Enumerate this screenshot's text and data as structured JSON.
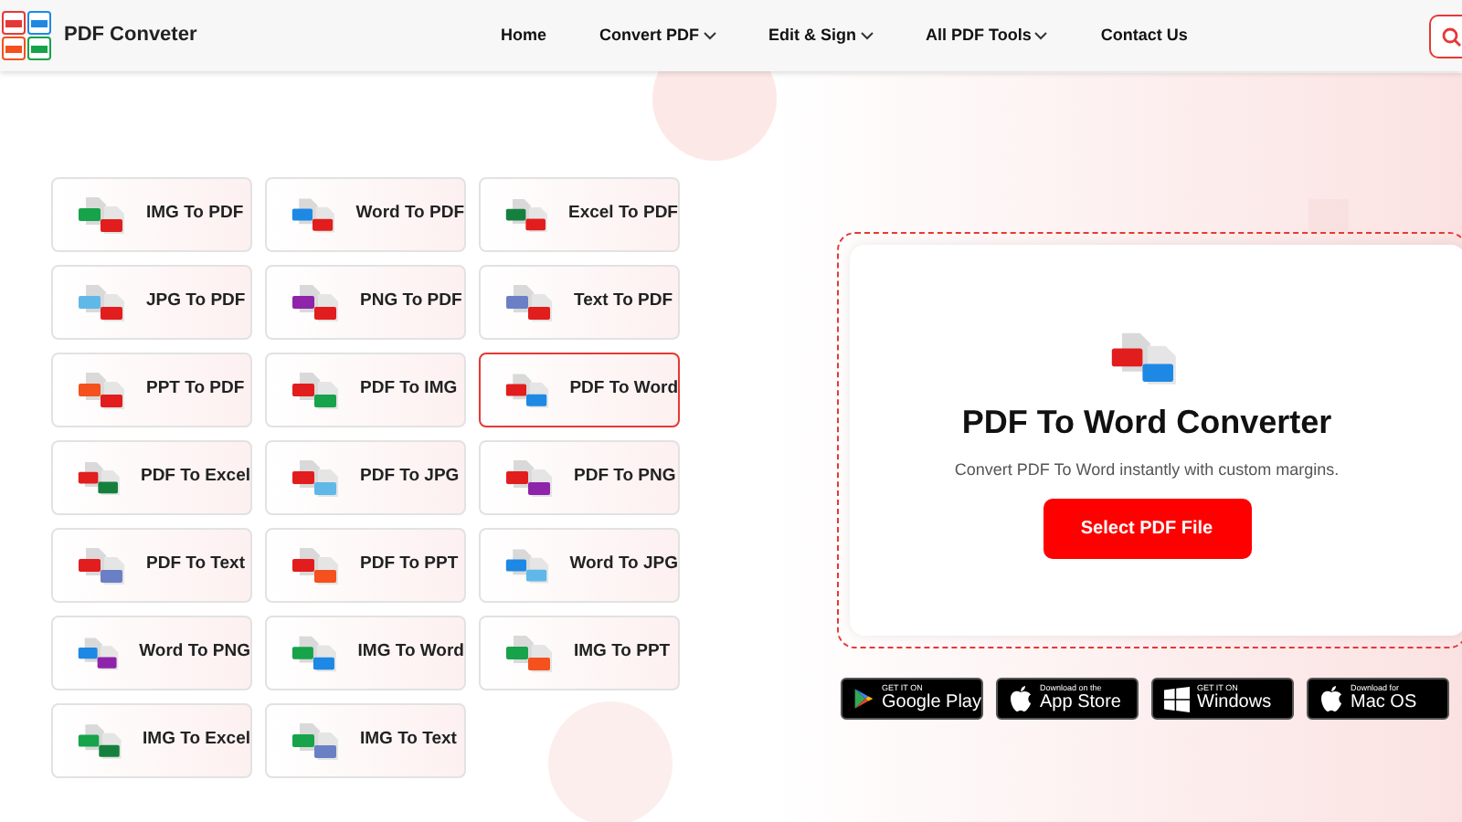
{
  "header": {
    "brand": "PDF Conveter",
    "nav": [
      {
        "label": "Home",
        "dropdown": false
      },
      {
        "label": "Convert PDF",
        "dropdown": true
      },
      {
        "label": "Edit & Sign",
        "dropdown": true
      },
      {
        "label": "All PDF Tools",
        "dropdown": true
      },
      {
        "label": "Contact Us",
        "dropdown": false
      }
    ]
  },
  "tools": [
    {
      "label": "IMG To PDF",
      "selected": false,
      "badges": [
        {
          "color": "#16a34a"
        },
        {
          "color": "#e11d1d"
        }
      ]
    },
    {
      "label": "Word To PDF",
      "selected": false,
      "badges": [
        {
          "color": "#1e88e5"
        },
        {
          "color": "#e11d1d"
        }
      ]
    },
    {
      "label": "Excel To PDF",
      "selected": false,
      "badges": [
        {
          "color": "#15803d"
        },
        {
          "color": "#e11d1d"
        }
      ]
    },
    {
      "label": "JPG To PDF",
      "selected": false,
      "badges": [
        {
          "color": "#60b8e8"
        },
        {
          "color": "#e11d1d"
        }
      ]
    },
    {
      "label": "PNG To PDF",
      "selected": false,
      "badges": [
        {
          "color": "#8e24aa"
        },
        {
          "color": "#e11d1d"
        }
      ]
    },
    {
      "label": "Text To PDF",
      "selected": false,
      "badges": [
        {
          "color": "#6b7fc4"
        },
        {
          "color": "#e11d1d"
        }
      ]
    },
    {
      "label": "PPT To PDF",
      "selected": false,
      "badges": [
        {
          "color": "#f4511e"
        },
        {
          "color": "#e11d1d"
        }
      ]
    },
    {
      "label": "PDF To IMG",
      "selected": false,
      "badges": [
        {
          "color": "#e11d1d"
        },
        {
          "color": "#16a34a"
        }
      ]
    },
    {
      "label": "PDF To Word",
      "selected": true,
      "badges": [
        {
          "color": "#e11d1d"
        },
        {
          "color": "#1e88e5"
        }
      ]
    },
    {
      "label": "PDF To Excel",
      "selected": false,
      "badges": [
        {
          "color": "#e11d1d"
        },
        {
          "color": "#15803d"
        }
      ]
    },
    {
      "label": "PDF To JPG",
      "selected": false,
      "badges": [
        {
          "color": "#e11d1d"
        },
        {
          "color": "#60b8e8"
        }
      ]
    },
    {
      "label": "PDF To PNG",
      "selected": false,
      "badges": [
        {
          "color": "#e11d1d"
        },
        {
          "color": "#8e24aa"
        }
      ]
    },
    {
      "label": "PDF To Text",
      "selected": false,
      "badges": [
        {
          "color": "#e11d1d"
        },
        {
          "color": "#6b7fc4"
        }
      ]
    },
    {
      "label": "PDF To PPT",
      "selected": false,
      "badges": [
        {
          "color": "#e11d1d"
        },
        {
          "color": "#f4511e"
        }
      ]
    },
    {
      "label": "Word To JPG",
      "selected": false,
      "badges": [
        {
          "color": "#1e88e5"
        },
        {
          "color": "#60b8e8"
        }
      ]
    },
    {
      "label": "Word To PNG",
      "selected": false,
      "badges": [
        {
          "color": "#1e88e5"
        },
        {
          "color": "#8e24aa"
        }
      ]
    },
    {
      "label": "IMG To Word",
      "selected": false,
      "badges": [
        {
          "color": "#16a34a"
        },
        {
          "color": "#1e88e5"
        }
      ]
    },
    {
      "label": "IMG To PPT",
      "selected": false,
      "badges": [
        {
          "color": "#16a34a"
        },
        {
          "color": "#f4511e"
        }
      ]
    },
    {
      "label": "IMG To Excel",
      "selected": false,
      "badges": [
        {
          "color": "#16a34a"
        },
        {
          "color": "#15803d"
        }
      ]
    },
    {
      "label": "IMG To Text",
      "selected": false,
      "badges": [
        {
          "color": "#16a34a"
        },
        {
          "color": "#6b7fc4"
        }
      ]
    }
  ],
  "converter": {
    "title": "PDF To Word Converter",
    "subtitle": "Convert PDF To Word instantly with custom margins.",
    "button": "Select PDF File",
    "badges": [
      {
        "color": "#e11d1d"
      },
      {
        "color": "#1e88e5"
      }
    ]
  },
  "stores": [
    {
      "kind": "google",
      "small": "GET IT ON",
      "big": "Google Play"
    },
    {
      "kind": "apple",
      "small": "Download on the",
      "big": "App Store"
    },
    {
      "kind": "windows",
      "small": "GET IT ON",
      "big": "Windows"
    },
    {
      "kind": "apple",
      "small": "Download for",
      "big": "Mac OS"
    }
  ]
}
